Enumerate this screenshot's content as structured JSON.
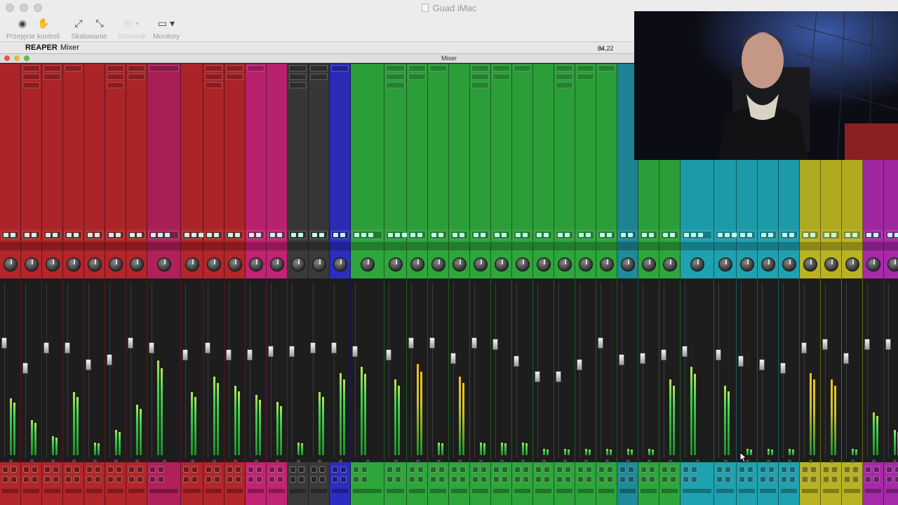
{
  "screen_share": {
    "title": "Guad iMac",
    "toolbar": [
      {
        "label": "Przejęcie kontroli",
        "icons": [
          "pointer-icon",
          "hand-icon"
        ],
        "enabled": true
      },
      {
        "label": "Skalowanie",
        "icons": [
          "expand-icon",
          "shrink-icon"
        ],
        "enabled": true
      },
      {
        "label": "Schowek",
        "icons": [
          "clipboard-icon"
        ],
        "enabled": false
      },
      {
        "label": "Monitory",
        "icons": [
          "monitor-icon"
        ],
        "enabled": true
      }
    ]
  },
  "menubar": {
    "app_name": "REAPER",
    "menu": "Mixer",
    "status": "84,22"
  },
  "mixer_window": {
    "title": "Mixer"
  },
  "colors": {
    "red": "#b3262a",
    "pink": "#c22373",
    "magenta": "#b0215a",
    "gray": "#3a3a3a",
    "blue": "#2c2cc0",
    "green": "#2ea63c",
    "teal": "#1e8a9a",
    "cyan": "#1fa2b0",
    "yellow": "#b9b322",
    "purple": "#a72aa8"
  }
}
